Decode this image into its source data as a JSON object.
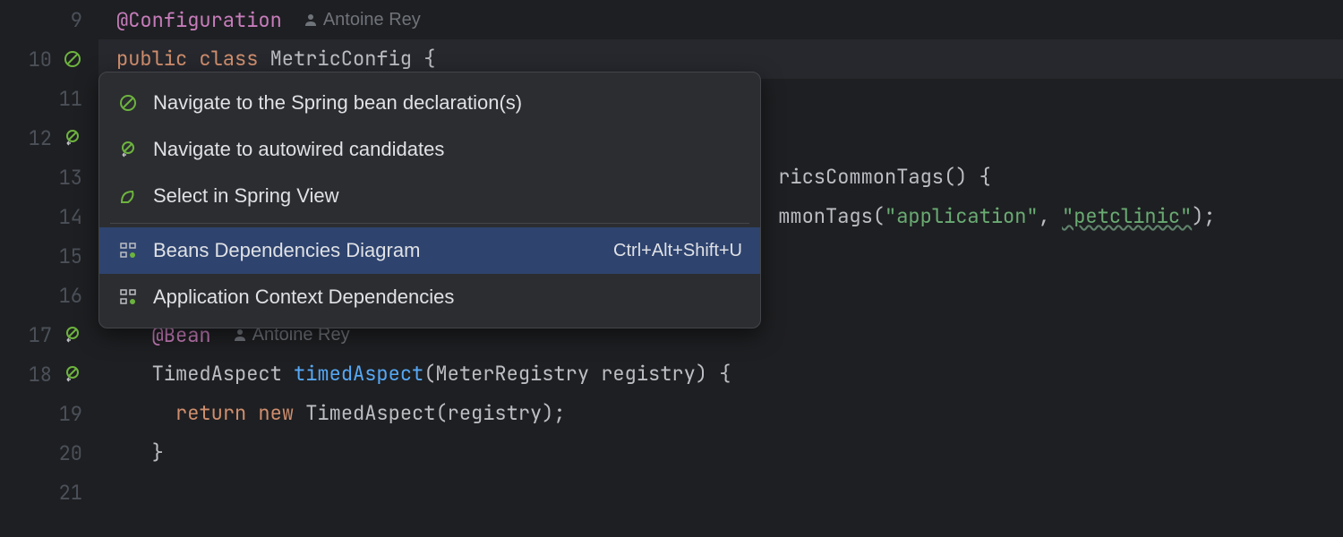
{
  "gutter": {
    "lines": [
      "9",
      "10",
      "11",
      "12",
      "13",
      "14",
      "15",
      "16",
      "17",
      "18",
      "19",
      "20",
      "21"
    ]
  },
  "code": {
    "line9_annotation": "@Configuration",
    "line9_author": "Antoine Rey",
    "line10": "public class MetricConfig {",
    "line13_suffix": "ricsCommonTags() {",
    "line14_part1": "mmonTags(",
    "line14_str1": "\"application\"",
    "line14_comma": ", ",
    "line14_str2": "\"petclinic\"",
    "line14_end": ");",
    "line17_annotation": "@Bean",
    "line17_author": "Antoine Rey",
    "line18_type": "TimedAspect ",
    "line18_method": "timedAspect",
    "line18_params": "(MeterRegistry registry) {",
    "line19_ret": "return ",
    "line19_new": "new ",
    "line19_rest": "TimedAspect(registry);",
    "line20": "}"
  },
  "menu": {
    "item1": "Navigate to the Spring bean declaration(s)",
    "item2": "Navigate to autowired candidates",
    "item3": "Select in Spring View",
    "item4": "Beans Dependencies Diagram",
    "item4_shortcut": "Ctrl+Alt+Shift+U",
    "item5": "Application Context Dependencies"
  }
}
